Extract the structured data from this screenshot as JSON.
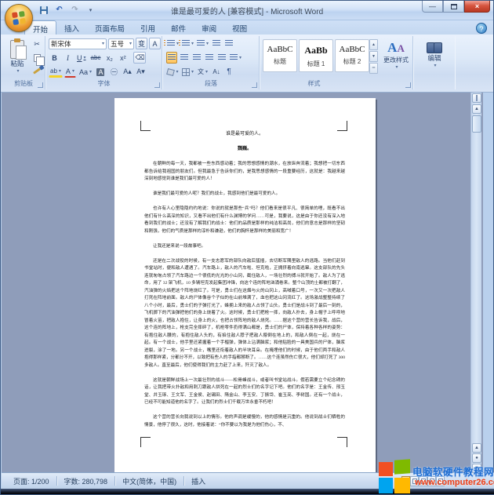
{
  "window": {
    "title": "谁是最可爱的人 [兼容模式] - Microsoft Word",
    "controls": {
      "minimize": "最小化",
      "maximize": "最大化",
      "close": "×"
    }
  },
  "quick_access": {
    "save": "保存",
    "undo": "↶",
    "redo": "↷",
    "more": "▾"
  },
  "tabs": [
    {
      "label": "开始",
      "active": true
    },
    {
      "label": "插入",
      "active": false
    },
    {
      "label": "页面布局",
      "active": false
    },
    {
      "label": "引用",
      "active": false
    },
    {
      "label": "邮件",
      "active": false
    },
    {
      "label": "审阅",
      "active": false
    },
    {
      "label": "视图",
      "active": false
    }
  ],
  "help_label": "?",
  "ribbon": {
    "clipboard": {
      "group_label": "剪贴板",
      "paste_label": "粘贴",
      "paste_caret": "▾"
    },
    "font": {
      "group_label": "字体",
      "font_name": "新宋体",
      "font_size": "五号",
      "bold": "B",
      "italic": "I",
      "underline": "U",
      "strikethrough": "abc",
      "subscript": "x₂",
      "superscript": "x²",
      "phonetic": "变",
      "char_border": "A",
      "highlight": "ab",
      "font_color": "A",
      "change_case": "Aa",
      "char_shading": "A",
      "enclose": "㊀",
      "grow": "A▴",
      "shrink": "A▾"
    },
    "paragraph": {
      "group_label": "段落",
      "sort": "A↓",
      "marks": "¶"
    },
    "styles": {
      "group_label": "样式",
      "items": [
        {
          "preview": "AaBbC",
          "name": "标题"
        },
        {
          "preview": "AaBb",
          "name": "标题 1"
        },
        {
          "preview": "AaBbC",
          "name": "标题 2"
        }
      ],
      "change_styles": "更改样式",
      "scroll_up": "▲",
      "scroll_down": "▼",
      "scroll_more": "＝"
    },
    "editing": {
      "group_label": "编辑",
      "button_label": "编辑",
      "caret": "▾"
    }
  },
  "document": {
    "title": "谁是最可爱的人。",
    "author": "魏巍。",
    "paragraphs": [
      "在朝鲜的每一天，我都被一些东西感动着；我的思想感情的潮水，在放纵奔流着；我想把一切东西都告诉给我祖国的朋友们。但我最急于告诉你们的，是我思想感情的一段重要经历，这就是：我越来越深刻地感觉到谁是我们最可爱的人！",
      "谁是我们最可爱的人呢？我们的战士，我感到他们是最可爱的人。",
      "也许有人心里隐隐约约地说：你说的就是那些“兵”吗？他们看来是很平凡、很简单的哩，既看不出他们有什么高深的知识，又看不出他们有什么渊博的学问……可是，我要说，这是由于你还没有深入地看到我们的战士；还没有了解我们的战士：他们的品质是那样的纯洁和高尚，他们的意志是那样的坚韧和刚强，他们的气质是那样的淳朴和谦逊，他们的胸怀是那样的美丽和宽广！",
      "让我还是来说一段故事吧。",
      "还是在二次战役的时候，有一支志愿军的部队向敌后猛插，去切断军隅里敌人的逃路。当他们赶到书堂站时，便和敌人遭遇了。汽车路上，敌人的汽车啦、坦克啦，正拥挤着向南逃窜。这支部队的先头连就匆匆占领了汽车路边一个很低的光光的小山冈，截住敌人，一场壮烈的搏斗就开始了。敌人为了逃命，用了 32 架飞机，10 多辆坦克发起集团冲锋，向这个连的阵地汹涌卷来。整个山顶的土都被打翻了，汽油弹的火焰把这个阵地烧红了。可是，勇士们在这烟与火的山冈上，高喊着口号，一次又一次把敌人打死在阵地前面。敌人的尸体像谷个子似的在山前堆满了，血也把这山冈流红了。这场激战整整持续了八个小时，最后，勇士们的子弹打光了。蜂拥上来的敌人占领了山头。勇士们是战斗到了最后一刻的，飞机掷下的汽油弹把他们的身上烧着了火。这时候，勇士们把枪一摔，向敌人扑去，身上帽子上呼呼地冒着火苗，把敌人抱住，让身上的火，也把占领阵地的敌人烧死。……据这个营的营长告诉我，战后，这个连的阵地上，枪支完全摔碎了，机枪零件扔得满山都是，勇士们的尸体，保持着各种各样的姿势：有抱住敌人腰的，有抱住敌人头的，有掐住敌人脖子把敌人摁倒在地上的，和敌人倒在一起，烧在一起。有一个战士，他手里还紧握着一个手榴弹，弹体上沾满脑浆；和他贴脸的一具美国兵的尸体，脑浆迸裂，涂了一地。另一个战士，嘴里还衔着敌人的半块耳朵。在掩埋他们的时候，由于他们两手和敌人抱得那样紧，分都分不开，以致把有些人的手指都掰断了。……这个连虽然伤亡很大，他们却打死了 300 多敌人。直至最后，他们使得我们的主力赶了上来，歼灭了敌人。",
      "这就是朝鲜战场上一次最壮烈的战斗——松骨峰战斗，或者叫书堂站战斗。假若需要立个纪念碑的话，让我把带火扑敌和用刺刀跟敌人拼死在一起的烈士们的名字记下吧。他们的名字是：王金传、邢玉堂、井玉琢、王文军、王金侯、赵锡田、隋金山、李玉安、丁振岱、崔玉亮、李树国。还有一个战士，已经不可能知道他的名字了。让我们的烈士们千载万世永垂不朽吧！",
      "这个营的营长向我说到以上的情形。他的声调是缓慢的，他的感情是沉重的。他说到战士们牺牲的情景，他停了很久，这时，他接着说：“你不要以为我是为他们伤心，不、"
    ]
  },
  "status_bar": {
    "page": "页面: 1/200",
    "word_count": "字数: 280,798",
    "language": "中文(简体，中国)",
    "insert_mode": "插入"
  },
  "watermark": {
    "site_name": "电脑软硬件教程网",
    "site_url": "www.computer26.com"
  }
}
